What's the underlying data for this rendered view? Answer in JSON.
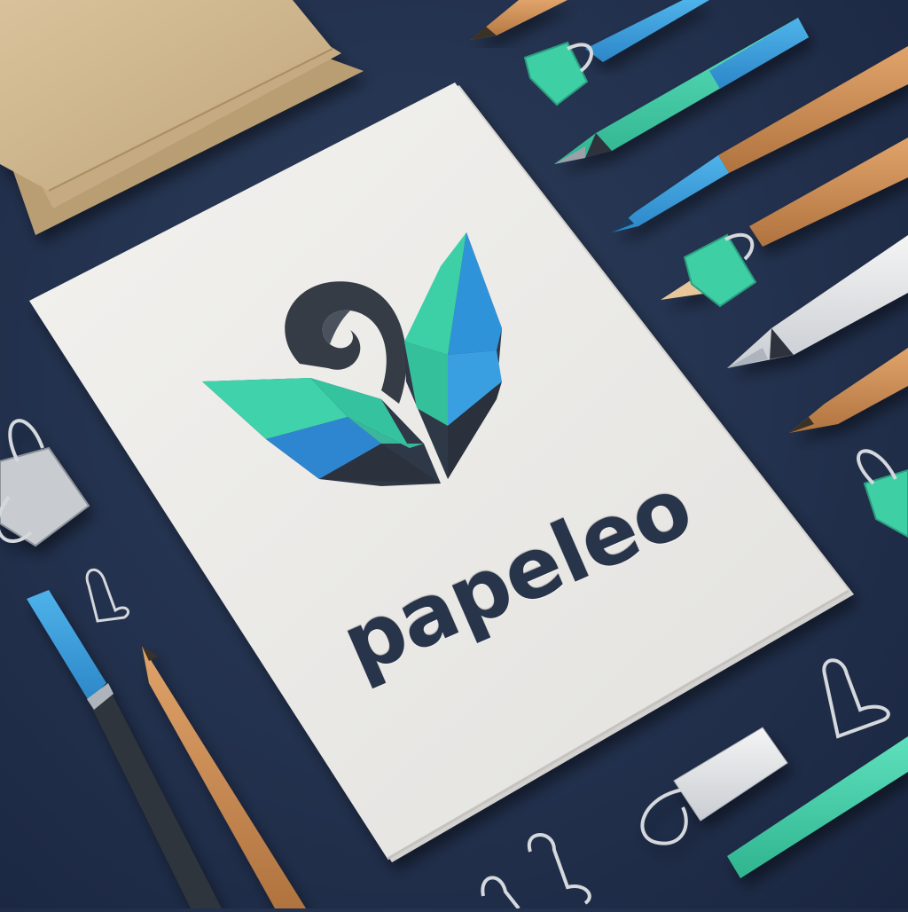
{
  "brand": {
    "name": "papeleo"
  },
  "colors": {
    "background": "#243350",
    "paper": "#ecebe8",
    "kraft": "#cdb48c",
    "teal": "#3ecfa6",
    "blue": "#2f8fd8",
    "dark": "#2f3846",
    "wood": "#c98a52"
  },
  "icons": [
    "leaf-logo-icon",
    "swirl-icon",
    "binder-clip-icon",
    "pencil-icon",
    "pen-icon",
    "eraser-icon"
  ]
}
